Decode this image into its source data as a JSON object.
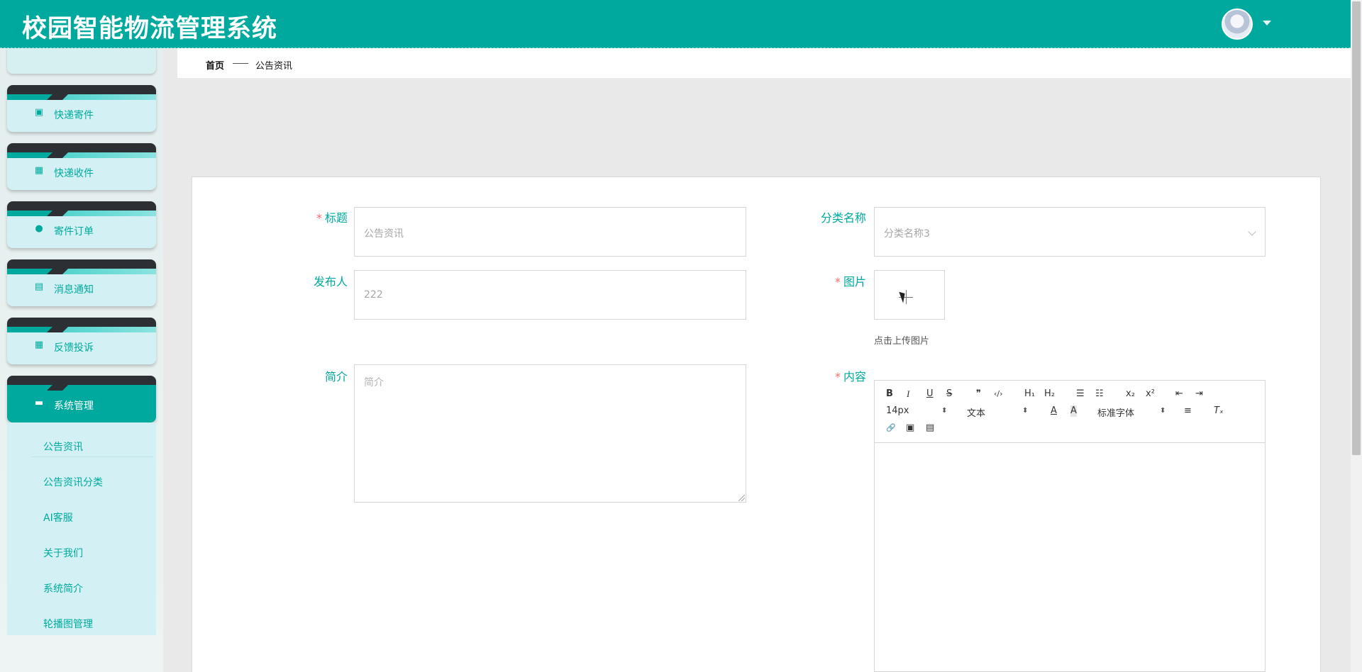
{
  "app": {
    "title": "校园智能物流管理系统"
  },
  "header": {
    "avatar_icon": "user-avatar",
    "caret_icon": "caret-down-icon"
  },
  "sidebar": {
    "menu": [
      {
        "label": "快递寄件",
        "icon": "ticket-icon",
        "glyph": "▣"
      },
      {
        "label": "快递收件",
        "icon": "grid-icon",
        "glyph": "▦"
      },
      {
        "label": "寄件订单",
        "icon": "bulb-icon",
        "glyph": "●"
      },
      {
        "label": "消息通知",
        "icon": "clipboard-icon",
        "glyph": "▤"
      },
      {
        "label": "反馈投诉",
        "icon": "grid-icon",
        "glyph": "▦"
      },
      {
        "label": "系统管理",
        "icon": "monitor-icon",
        "glyph": "▬",
        "active": true
      }
    ],
    "submenu": [
      {
        "label": "公告资讯"
      },
      {
        "label": "公告资讯分类"
      },
      {
        "label": "AI客服"
      },
      {
        "label": "关于我们"
      },
      {
        "label": "系统简介"
      },
      {
        "label": "轮播图管理"
      }
    ]
  },
  "breadcrumb": {
    "home": "首页",
    "current": "公告资讯"
  },
  "form": {
    "title": {
      "label": "标题",
      "value": "公告资讯",
      "required": true
    },
    "category": {
      "label": "分类名称",
      "value": "分类名称3"
    },
    "publisher": {
      "label": "发布人",
      "value": "222"
    },
    "image": {
      "label": "图片",
      "hint": "点击上传图片",
      "required": true
    },
    "summary": {
      "label": "简介",
      "placeholder": "简介"
    },
    "content": {
      "label": "内容",
      "required": true
    }
  },
  "editor": {
    "buttons_row1": [
      "B",
      "I",
      "U",
      "S",
      "❞",
      "‹/›",
      "H₁",
      "H₂",
      "☰",
      "☷",
      "x₂",
      "x²",
      "⇤",
      "⇥"
    ],
    "font_size": "14px",
    "block_type": "文本",
    "font_color_icon": "A",
    "bg_color_icon": "A",
    "font_family": "标准字体",
    "align_icon": "≡",
    "clear_icon": "Tₓ",
    "buttons_row3": [
      "🔗",
      "▣",
      "▤"
    ]
  },
  "colors": {
    "brand": "#00a99d",
    "required": "#f56c6c"
  }
}
